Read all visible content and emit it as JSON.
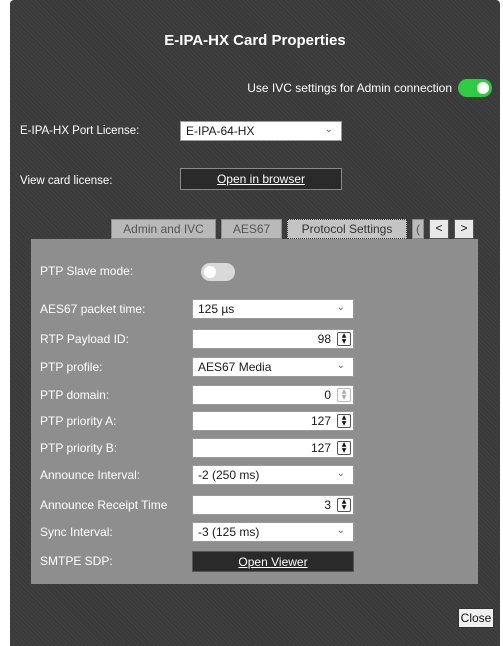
{
  "dialog": {
    "title": "E-IPA-HX Card Properties",
    "ivc_label": "Use IVC settings for Admin connection",
    "ivc_enabled": true,
    "port_license_label": "E-IPA-HX Port License:",
    "port_license_value": "E-IPA-64-HX",
    "view_license_label": "View card license:",
    "open_browser_label": "Open in browser"
  },
  "tabs": [
    {
      "label": "Admin and IVC",
      "active": false
    },
    {
      "label": "AES67",
      "active": false
    },
    {
      "label": "Protocol Settings",
      "active": true
    },
    {
      "label": "(",
      "active": false
    }
  ],
  "nav": {
    "prev": "<",
    "next": ">"
  },
  "protocol": {
    "ptp_slave": {
      "label": "PTP Slave mode:",
      "enabled": false
    },
    "packet_time": {
      "label": "AES67 packet time:",
      "value": "125 µs"
    },
    "rtp_payload": {
      "label": "RTP Payload ID:",
      "value": "98"
    },
    "ptp_profile": {
      "label": "PTP profile:",
      "value": "AES67 Media"
    },
    "ptp_domain": {
      "label": "PTP domain:",
      "value": "0"
    },
    "ptp_priority_a": {
      "label": "PTP priority A:",
      "value": "127"
    },
    "ptp_priority_b": {
      "label": "PTP priority B:",
      "value": "127"
    },
    "announce_interval": {
      "label": "Announce Interval:",
      "value": "-2 (250 ms)"
    },
    "announce_receipt": {
      "label": "Announce Receipt Time",
      "value": "3"
    },
    "sync_interval": {
      "label": "Sync Interval:",
      "value": "-3 (125 ms)"
    },
    "smtpe_sdp": {
      "label": "SMTPE SDP:",
      "button": "Open Viewer"
    }
  },
  "footer": {
    "close_label": "Close"
  },
  "colors": {
    "toggle_on": "#2ecc40",
    "window_bg": "#3a3a3a",
    "panel_bg": "#8e8e8e"
  }
}
